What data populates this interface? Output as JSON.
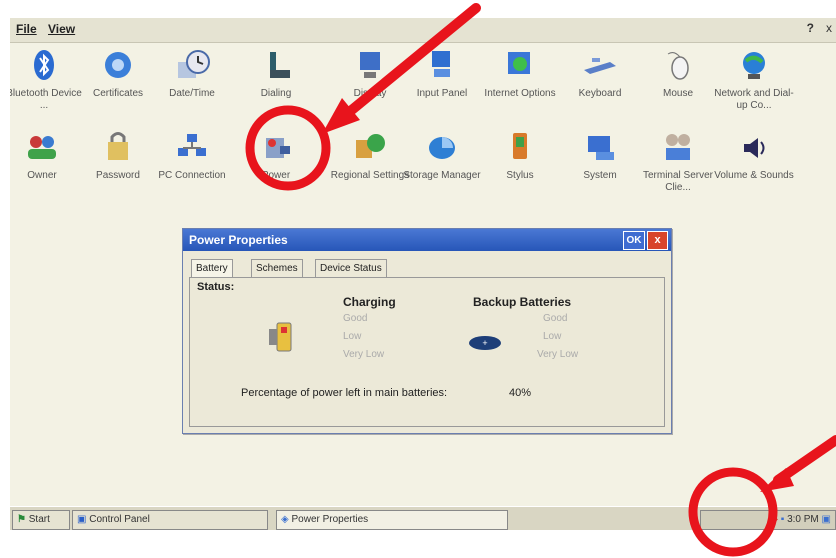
{
  "menubar": {
    "file_label": "File",
    "view_label": "View",
    "help_label": "?",
    "close_label": "x"
  },
  "control_panel": {
    "row1": [
      "Bluetooth Device ...",
      "Certificates",
      "Date/Time",
      "Dialing",
      "Display",
      "Input Panel",
      "Internet Options",
      "Keyboard",
      "Mouse",
      "Network and Dial-up Co..."
    ],
    "row2": [
      "Owner",
      "Password",
      "PC Connection",
      "Power",
      "Regional Settings",
      "Storage Manager",
      "Stylus",
      "System",
      "Terminal Server Clie...",
      "Volume & Sounds"
    ],
    "icons_row1": [
      "bluetooth-icon",
      "certificates-icon",
      "datetime-icon",
      "dialing-icon",
      "display-icon",
      "input-panel-icon",
      "internet-options-icon",
      "keyboard-icon",
      "mouse-icon",
      "network-icon"
    ],
    "icons_row2": [
      "owner-icon",
      "password-icon",
      "pc-connection-icon",
      "power-icon",
      "regional-settings-icon",
      "storage-manager-icon",
      "stylus-icon",
      "system-icon",
      "terminal-server-icon",
      "volume-sounds-icon"
    ]
  },
  "dialog": {
    "title": "Power Properties",
    "ok_label": "OK",
    "close_label": "x",
    "tabs": [
      "Battery",
      "Schemes",
      "Device Status"
    ],
    "status_label": "Status:",
    "charging_header": "Charging",
    "backup_header": "Backup Batteries",
    "charging_levels": [
      "Good",
      "Low",
      "Very Low"
    ],
    "backup_levels": [
      "Good",
      "Low",
      "Very Low"
    ],
    "percentage_label": "Percentage of power left in main batteries:",
    "percentage_value": "40%"
  },
  "taskbar": {
    "start_label": "Start",
    "control_panel_label": "Control Panel",
    "power_properties_label": "Power Properties",
    "clock": "3:0 PM"
  },
  "colors": {
    "annotation": "#e8141c",
    "titlebar": "#2f5fc4",
    "desktop": "#f3f2e4"
  }
}
